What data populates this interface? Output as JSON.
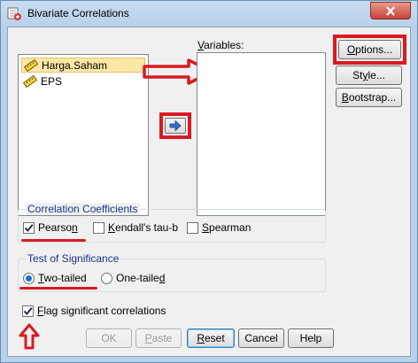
{
  "window": {
    "title": "Bivariate Correlations",
    "close_label": "✕"
  },
  "source_list": {
    "items": [
      {
        "label": "Harga.Saham",
        "icon": "scale-variable-icon",
        "selected": true
      },
      {
        "label": "EPS",
        "icon": "scale-variable-icon",
        "selected": false
      }
    ]
  },
  "variables": {
    "label_underlined": "V",
    "label_rest": "ariables:"
  },
  "buttons": {
    "options": {
      "u": "O",
      "rest": "ptions..."
    },
    "style": {
      "u": "",
      "pre": "St",
      "mid": "y",
      "post": "le..."
    },
    "bootstrap": {
      "u": "B",
      "rest": "ootstrap..."
    },
    "ok": "OK",
    "paste": {
      "u": "P",
      "rest": "aste"
    },
    "reset": {
      "u": "R",
      "rest": "eset"
    },
    "cancel": "Cancel",
    "help": "Help"
  },
  "correlation_coefficients": {
    "title": "Correlation Coefficients",
    "pearson": {
      "pre": "Pearso",
      "u": "n",
      "post": "",
      "checked": true
    },
    "kendall": {
      "u": "K",
      "rest": "endall's tau-b",
      "checked": false
    },
    "spearman": {
      "u": "S",
      "rest": "pearman",
      "checked": false
    }
  },
  "test_of_significance": {
    "title": "Test of Significance",
    "two_tailed": {
      "u": "T",
      "rest": "wo-tailed",
      "selected": true
    },
    "one_tailed": {
      "pre": "One-taile",
      "u": "d",
      "post": "",
      "selected": false
    }
  },
  "flag": {
    "u": "F",
    "rest": "lag significant correlations",
    "checked": true
  },
  "colors": {
    "annotation_red": "#d91a22",
    "group_title_blue": "#1e3287",
    "selection_yellow": "#fce8a6"
  }
}
